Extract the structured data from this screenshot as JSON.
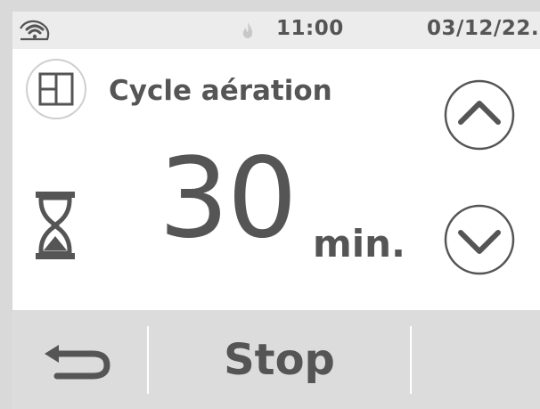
{
  "status_bar": {
    "wifi_icon": "wifi-icon",
    "flame_icon": "flame-icon",
    "time": "11:00",
    "date": "03/12/22."
  },
  "mode": {
    "icon": "window-icon",
    "title": "Cycle aération"
  },
  "timer": {
    "icon": "hourglass-icon",
    "value": "30",
    "unit": "min."
  },
  "controls": {
    "up_icon": "chevron-up-icon",
    "down_icon": "chevron-down-icon"
  },
  "bottom_bar": {
    "back_icon": "back-arrow-icon",
    "stop_label": "Stop"
  },
  "colors": {
    "text": "#555555",
    "status_bar_bg": "#ececec",
    "bottom_bar_bg": "#dcdcdc",
    "flame": "#c8c8c8"
  }
}
